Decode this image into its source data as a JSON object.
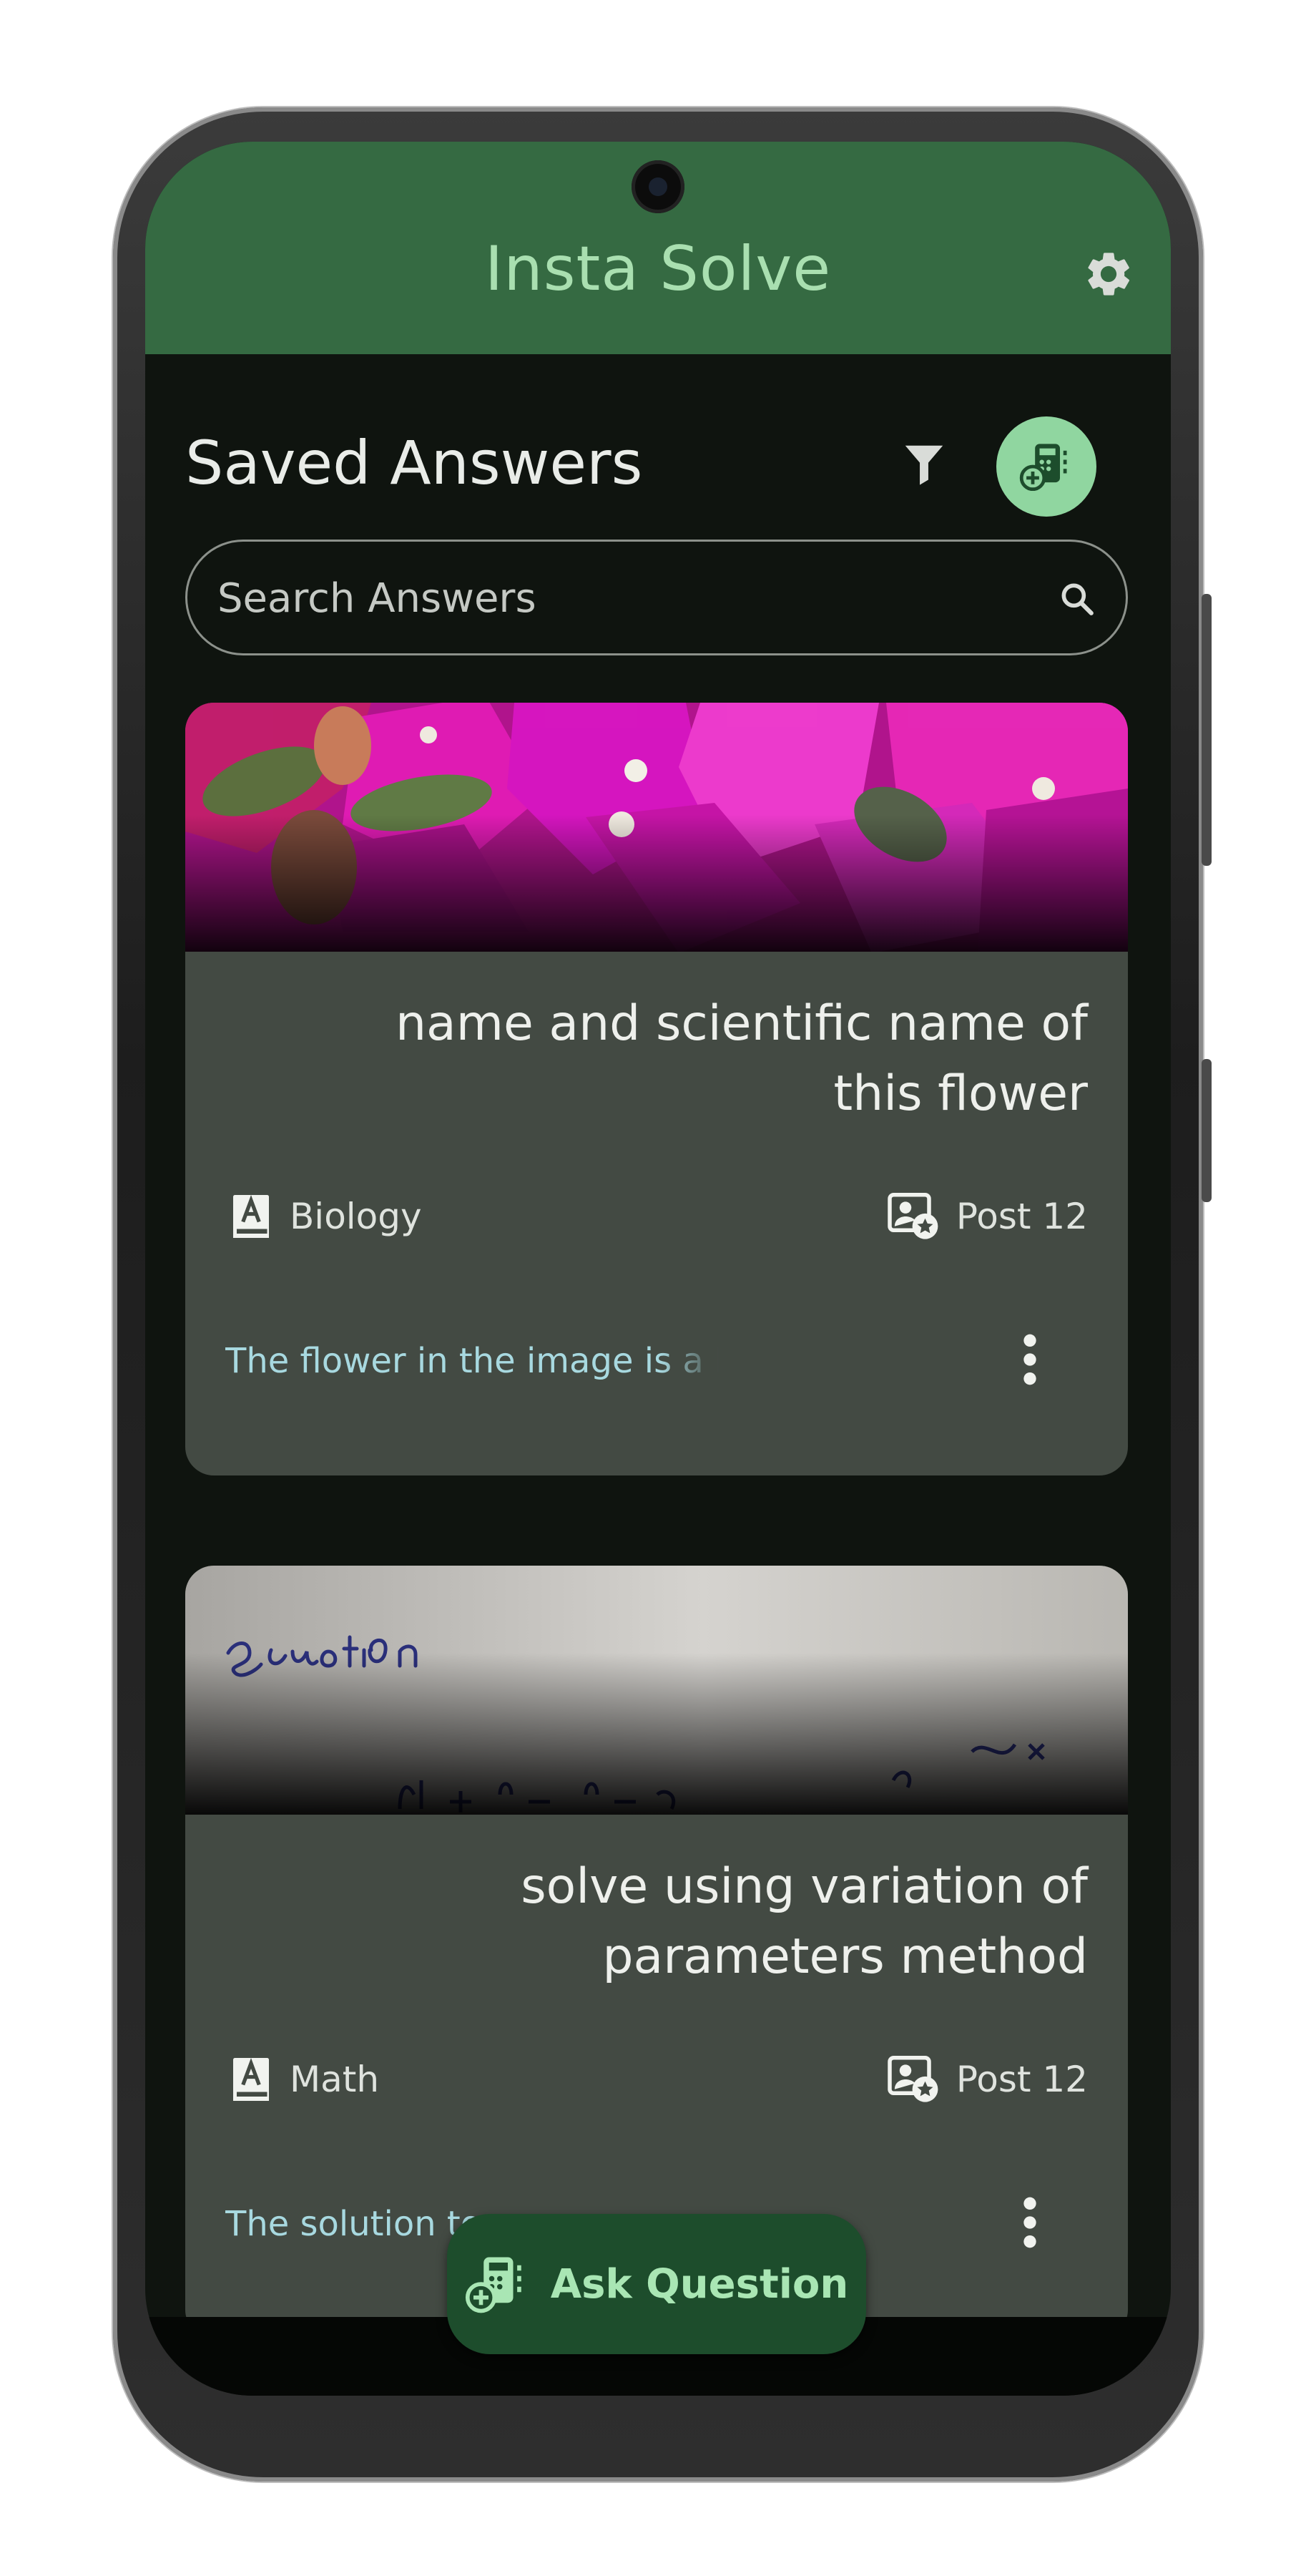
{
  "app": {
    "title": "Insta Solve"
  },
  "header": {
    "title": "Saved Answers"
  },
  "search": {
    "placeholder": "Search Answers"
  },
  "cards": [
    {
      "title": "name and scientific name of this flower",
      "subject": "Biology",
      "post": "Post 12",
      "preview": "The flower in the image is a Bo"
    },
    {
      "title": "solve using variation of parameters method",
      "subject": "Math",
      "post": "Post 12",
      "preview": "The solution to"
    }
  ],
  "fab": {
    "label": "Ask Question"
  },
  "icons": {
    "settings": "gear-icon",
    "filter": "filter-icon",
    "add": "calculator-add-icon",
    "search": "search-icon",
    "subject": "book-icon",
    "post": "badge-icon",
    "more": "more-vert-icon"
  },
  "colors": {
    "appbar": "#356a42",
    "title": "#a9dfb0",
    "background": "#0f140f",
    "card": "#434a43",
    "accent": "#90d6a0",
    "fab": "#1d4d2c",
    "preview_text": "#a8d9e0"
  }
}
